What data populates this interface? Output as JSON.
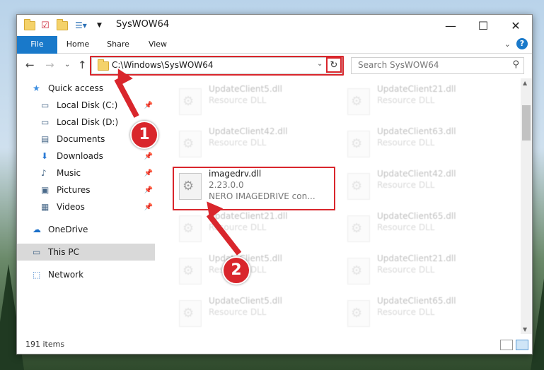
{
  "window": {
    "title": "SysWOW64"
  },
  "window_buttons": {
    "minimize": "—",
    "maximize": "☐",
    "close": "✕"
  },
  "ribbon": {
    "tabs": [
      "File",
      "Home",
      "Share",
      "View"
    ],
    "help": "?"
  },
  "address": {
    "path": "C:\\Windows\\SysWOW64",
    "refresh": "↻"
  },
  "search": {
    "placeholder": "Search SysWOW64"
  },
  "nav": {
    "items": [
      {
        "label": "Quick access",
        "icon": "star-icon",
        "pinned": false
      },
      {
        "label": "Local Disk (C:)",
        "icon": "drive-icon",
        "pinned": true
      },
      {
        "label": "Local Disk (D:)",
        "icon": "drive-icon",
        "pinned": false
      },
      {
        "label": "Documents",
        "icon": "documents-icon",
        "pinned": true
      },
      {
        "label": "Downloads",
        "icon": "download-icon",
        "pinned": true
      },
      {
        "label": "Music",
        "icon": "music-icon",
        "pinned": true
      },
      {
        "label": "Pictures",
        "icon": "pictures-icon",
        "pinned": true
      },
      {
        "label": "Videos",
        "icon": "videos-icon",
        "pinned": true
      },
      {
        "label": "OneDrive",
        "icon": "cloud-icon",
        "pinned": false
      },
      {
        "label": "This PC",
        "icon": "computer-icon",
        "pinned": false,
        "selected": true
      },
      {
        "label": "Network",
        "icon": "network-icon",
        "pinned": false
      }
    ]
  },
  "files": [
    {
      "name": "UpdateClient5.dll",
      "sub": "Resource DLL",
      "faded": true
    },
    {
      "name": "UpdateClient21.dll",
      "sub": "Resource DLL",
      "faded": true
    },
    {
      "name": "UpdateClient42.dll",
      "sub": "Resource DLL",
      "faded": true
    },
    {
      "name": "UpdateClient63.dll",
      "sub": "Resource DLL",
      "faded": true
    },
    {
      "name": "imagedrv.dll",
      "sub": "2.23.0.0",
      "sub2": "NERO IMAGEDRIVE con...",
      "faded": false
    },
    {
      "name": "UpdateClient42.dll",
      "sub": "Resource DLL",
      "faded": true
    },
    {
      "name": "UpdateClient21.dll",
      "sub": "Resource DLL",
      "faded": true
    },
    {
      "name": "UpdateClient65.dll",
      "sub": "Resource DLL",
      "faded": true
    },
    {
      "name": "UpdateClient5.dll",
      "sub": "Resource DLL",
      "faded": true
    },
    {
      "name": "UpdateClient21.dll",
      "sub": "Resource DLL",
      "faded": true
    },
    {
      "name": "UpdateClient5.dll",
      "sub": "Resource DLL",
      "faded": true
    },
    {
      "name": "UpdateClient65.dll",
      "sub": "Resource DLL",
      "faded": true
    }
  ],
  "status": {
    "count": "191 items"
  },
  "annotations": {
    "step1": "1",
    "step2": "2"
  },
  "colors": {
    "highlight": "#d9262c",
    "ribbon_file": "#1979ca"
  }
}
